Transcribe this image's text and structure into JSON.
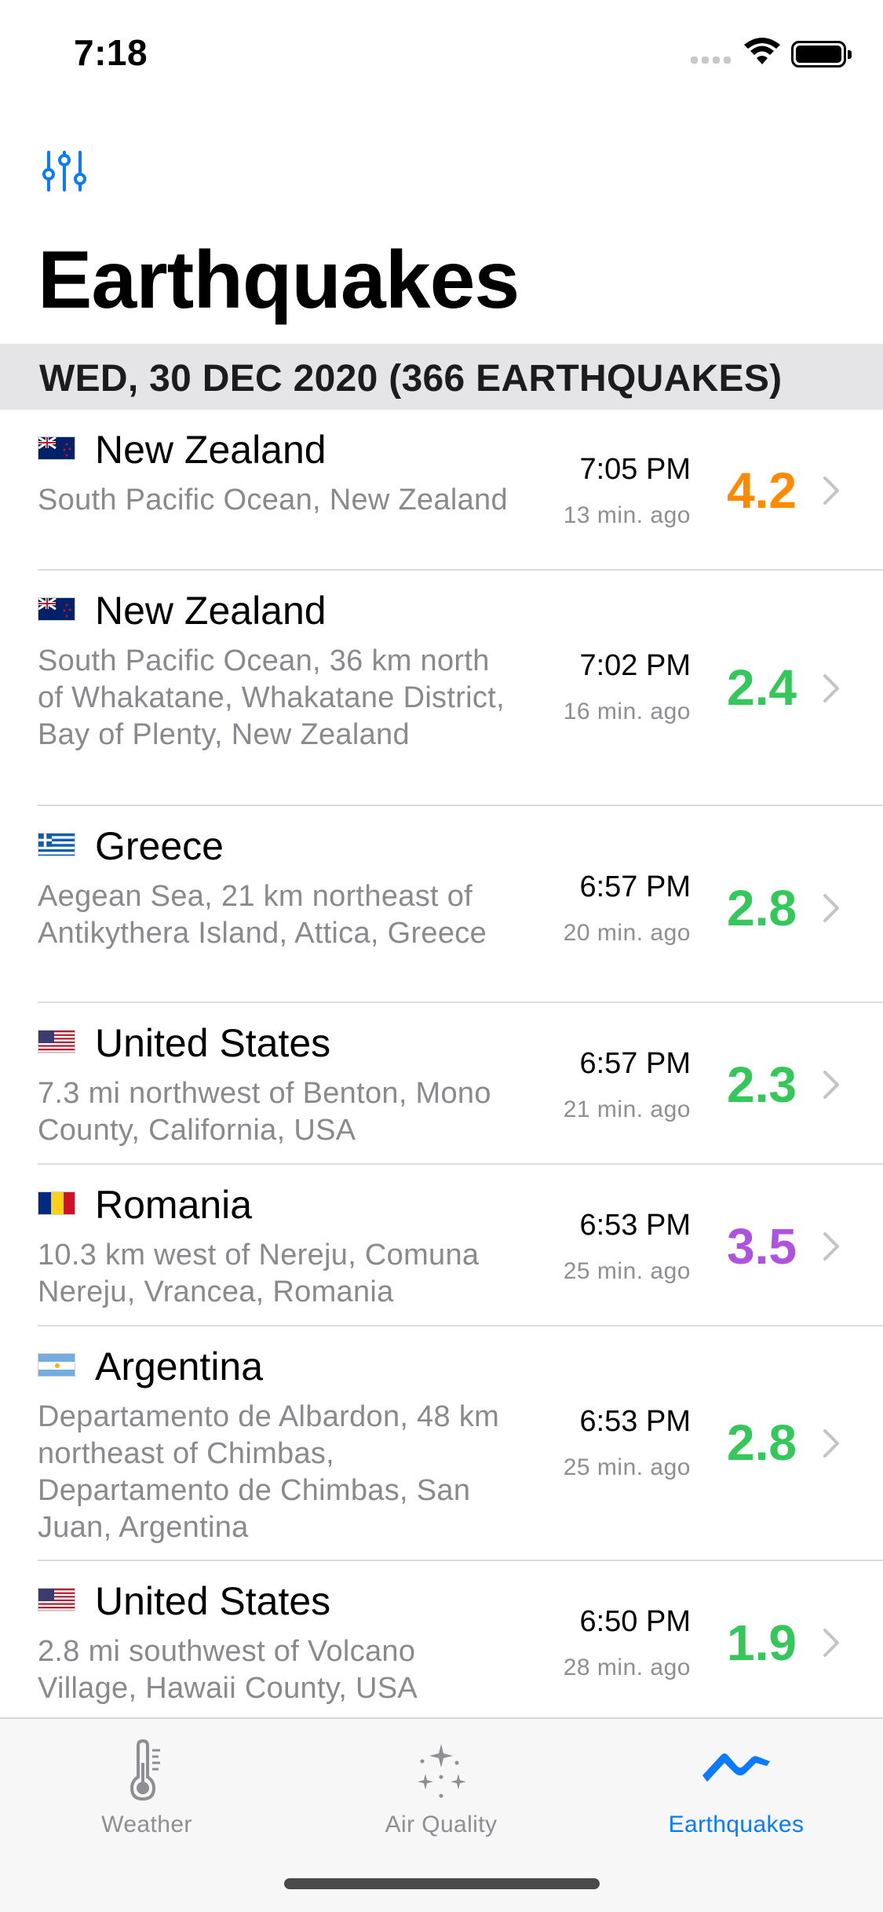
{
  "status_bar": {
    "time": "7:18"
  },
  "header": {
    "title": "Earthquakes"
  },
  "section": {
    "label": "WED, 30 DEC 2020  (366 EARTHQUAKES)"
  },
  "quakes": [
    {
      "country": "New Zealand",
      "flag": "new-zealand",
      "region": "South Pacific Ocean, New Zealand",
      "time": "7:05 PM",
      "ago": "13 min. ago",
      "magnitude": "4.2",
      "mag_color": "#ff8a00"
    },
    {
      "country": "New Zealand",
      "flag": "new-zealand",
      "region": "South Pacific Ocean, 36 km north of Whakatane, Whakatane District, Bay of Plenty, New Zealand",
      "time": "7:02 PM",
      "ago": "16 min. ago",
      "magnitude": "2.4",
      "mag_color": "#34c759"
    },
    {
      "country": "Greece",
      "flag": "greece",
      "region": "Aegean Sea, 21 km northeast of Antikythera Island, Attica, Greece",
      "time": "6:57 PM",
      "ago": "20 min. ago",
      "magnitude": "2.8",
      "mag_color": "#34c759"
    },
    {
      "country": "United States",
      "flag": "united-states",
      "region": "7.3 mi northwest of Benton, Mono County, California, USA",
      "time": "6:57 PM",
      "ago": "21 min. ago",
      "magnitude": "2.3",
      "mag_color": "#34c759"
    },
    {
      "country": "Romania",
      "flag": "romania",
      "region": "10.3 km west of Nereju, Comuna Nereju, Vrancea, Romania",
      "time": "6:53 PM",
      "ago": "25 min. ago",
      "magnitude": "3.5",
      "mag_color": "#af52de"
    },
    {
      "country": "Argentina",
      "flag": "argentina",
      "region": "Departamento de Albardon, 48 km northeast of Chimbas, Departamento de Chimbas, San Juan, Argentina",
      "time": "6:53 PM",
      "ago": "25 min. ago",
      "magnitude": "2.8",
      "mag_color": "#34c759"
    },
    {
      "country": "United States",
      "flag": "united-states",
      "region": "2.8 mi southwest of Volcano Village, Hawaii County, USA",
      "time": "6:50 PM",
      "ago": "28 min. ago",
      "magnitude": "1.9",
      "mag_color": "#34c759"
    }
  ],
  "tabs": [
    {
      "label": "Weather",
      "icon": "thermometer-icon",
      "active": false
    },
    {
      "label": "Air Quality",
      "icon": "sparkles-icon",
      "active": false
    },
    {
      "label": "Earthquakes",
      "icon": "seismic-wave-icon",
      "active": true
    }
  ],
  "colors": {
    "accent": "#0a7aff",
    "inactive": "#8e8e93"
  }
}
